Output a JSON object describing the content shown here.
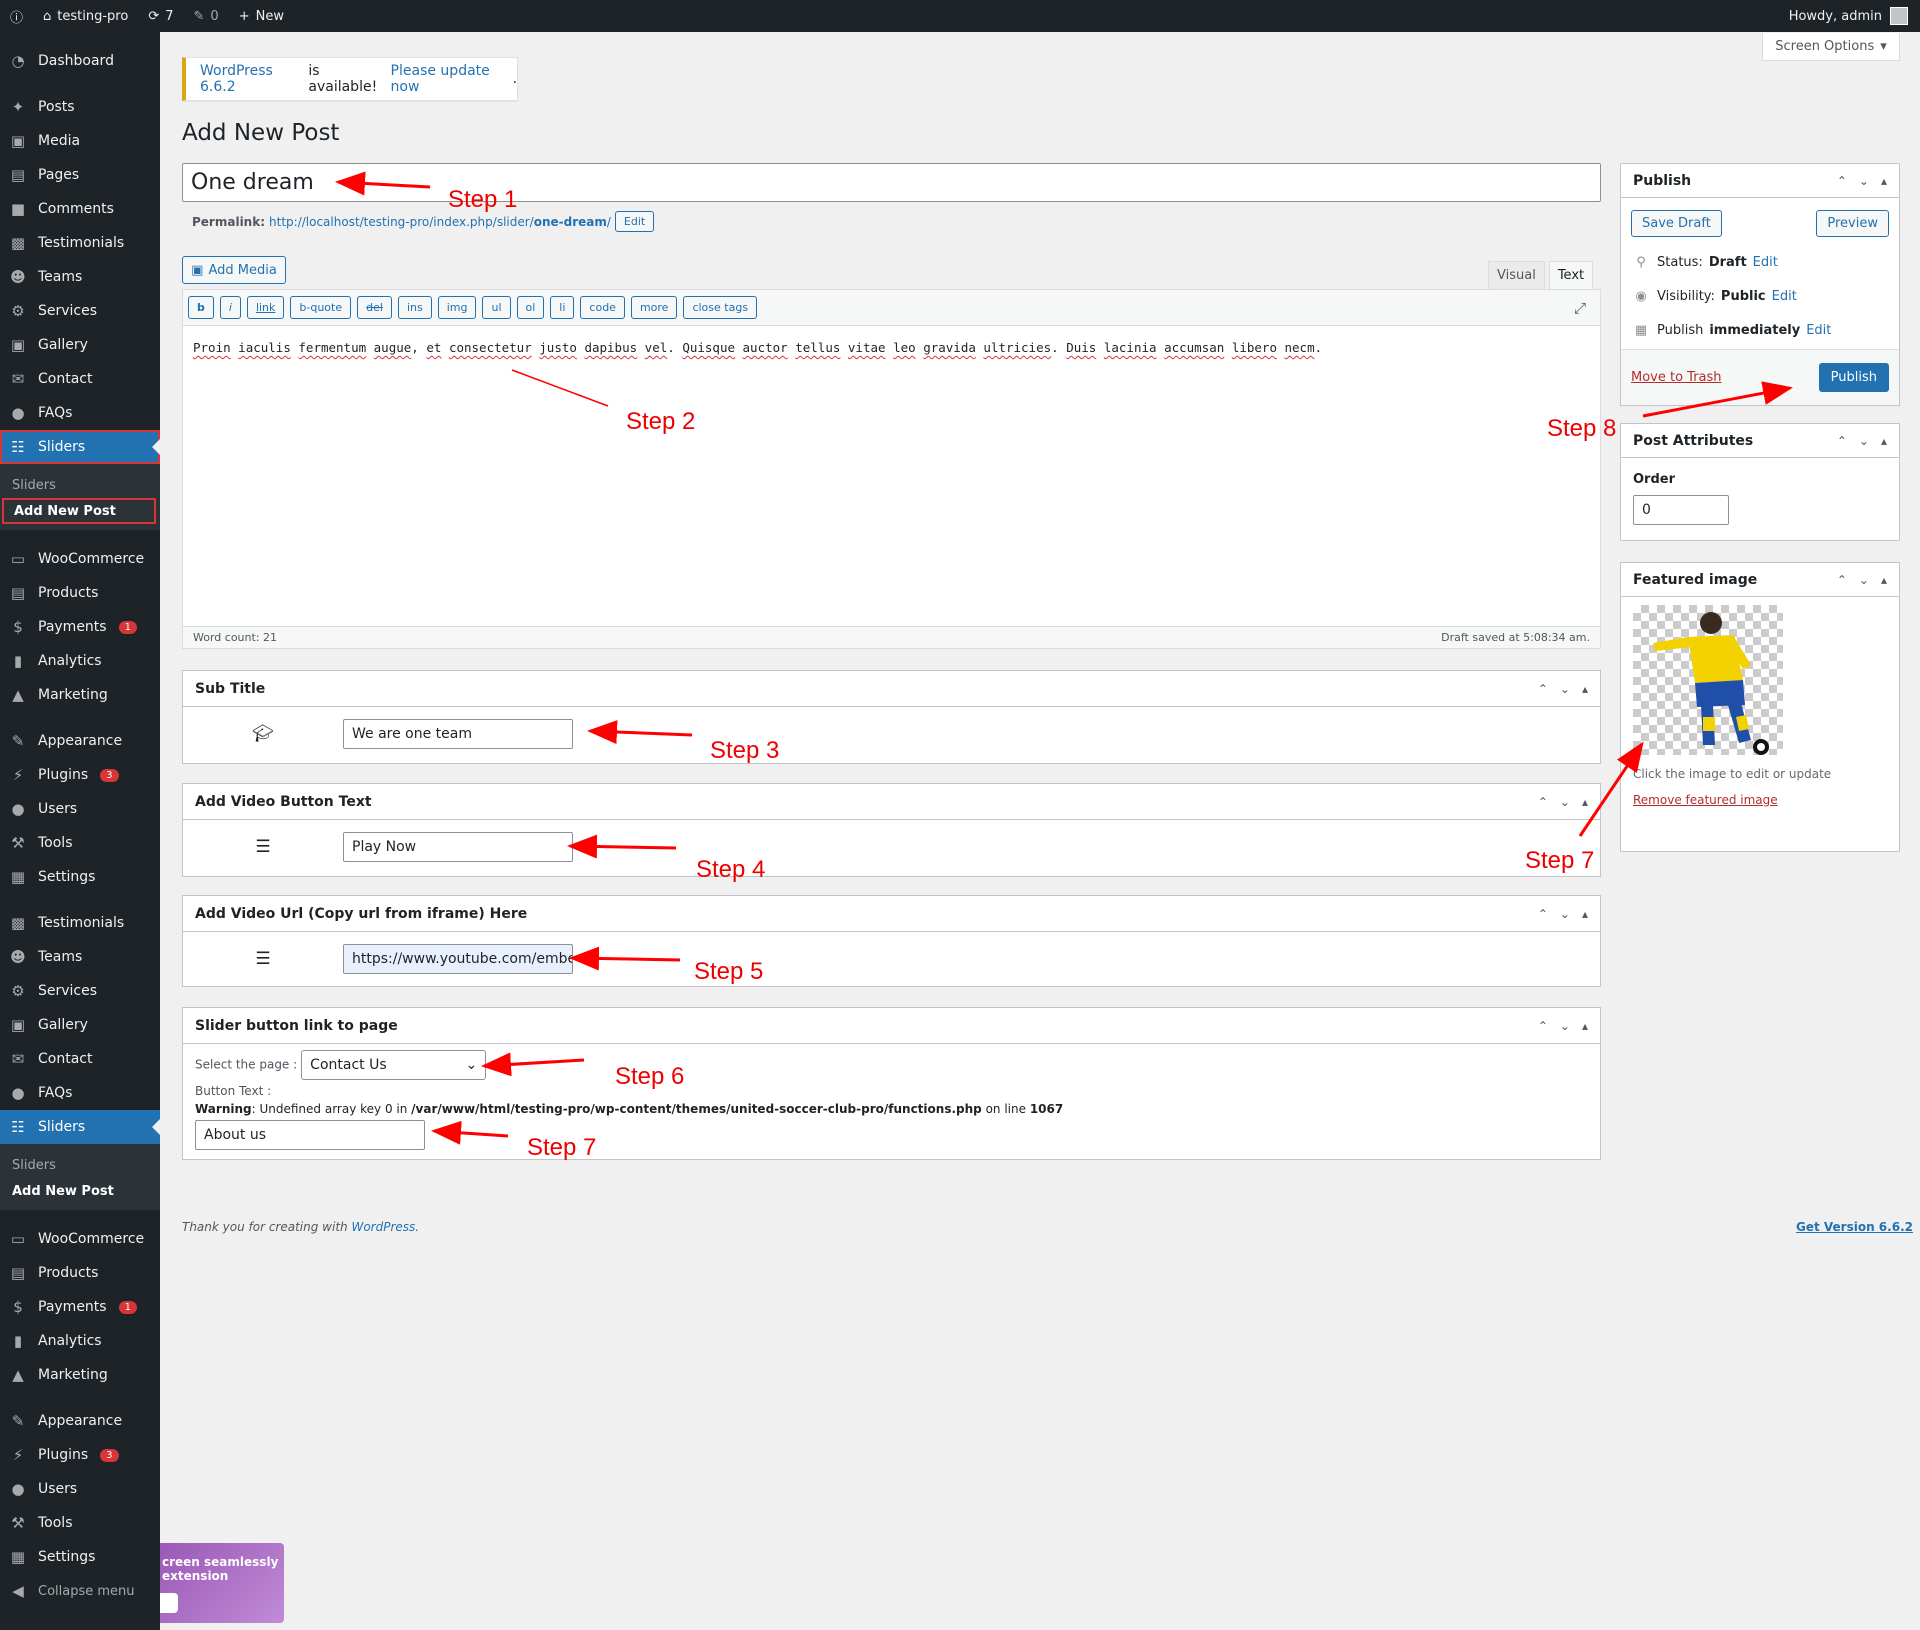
{
  "adminbar": {
    "site_name": "testing-pro",
    "updates_count": "7",
    "comments_count": "0",
    "new_label": "New",
    "howdy": "Howdy, admin"
  },
  "screen_options": "Screen Options",
  "notice": {
    "version_link": "WordPress 6.6.2",
    "text": "is available!",
    "update_link": "Please update now",
    "period": "."
  },
  "page_title": "Add New Post",
  "post": {
    "title": "One dream",
    "permalink_label": "Permalink:",
    "permalink_base": "http://localhost/testing-pro/index.php/slider/",
    "permalink_slug": "one-dream",
    "permalink_trail": "/",
    "edit_label": "Edit"
  },
  "editor": {
    "add_media": "Add Media",
    "tab_visual": "Visual",
    "tab_text": "Text",
    "buttons": [
      "b",
      "i",
      "link",
      "b-quote",
      "del",
      "ins",
      "img",
      "ul",
      "ol",
      "li",
      "code",
      "more",
      "close tags"
    ],
    "content_words": [
      "Proin",
      "iaculis",
      "fermentum",
      "augue,",
      "et",
      "consectetur",
      "justo",
      "dapibus",
      "vel.",
      "Quisque",
      "auctor",
      "tellus",
      "vitae",
      "leo",
      "gravida",
      "ultricies.",
      "Duis",
      "lacinia",
      "accumsan",
      "libero",
      "necm."
    ],
    "word_count": "Word count: 21",
    "draft_saved": "Draft saved at 5:08:34 am."
  },
  "metaboxes": {
    "subtitle": {
      "title": "Sub Title",
      "value": "We are one team"
    },
    "video_button": {
      "title": "Add Video Button Text",
      "value": "Play Now"
    },
    "video_url": {
      "title": "Add Video Url (Copy url from iframe) Here",
      "value": "https://www.youtube.com/embed"
    },
    "slider_link": {
      "title": "Slider button link to page",
      "select_label": "Select the page :",
      "select_value": "Contact Us",
      "button_text_label": "Button Text :",
      "warning_label": "Warning",
      "warning_text": ": Undefined array key 0 in",
      "warning_path": "/var/www/html/testing-pro/wp-content/themes/united-soccer-club-pro/functions.php",
      "warning_on_line": "on line",
      "warning_line": "1067",
      "button_text_value": "About us"
    }
  },
  "publish": {
    "title": "Publish",
    "save_draft": "Save Draft",
    "preview": "Preview",
    "status_label": "Status:",
    "status_value": "Draft",
    "visibility_label": "Visibility:",
    "visibility_value": "Public",
    "publish_label": "Publish",
    "publish_value": "immediately",
    "edit": "Edit",
    "move_to_trash": "Move to Trash",
    "publish_button": "Publish"
  },
  "post_attributes": {
    "title": "Post Attributes",
    "order_label": "Order",
    "order_value": "0"
  },
  "featured_image": {
    "title": "Featured image",
    "hint": "Click the image to edit or update",
    "remove": "Remove featured image"
  },
  "footer": {
    "thanks": "Thank you for creating with",
    "wp_link": "WordPress",
    "period": ".",
    "version": "Get Version 6.6.2"
  },
  "sidebar": {
    "group1": [
      "Dashboard",
      "Posts",
      "Media",
      "Pages",
      "Comments",
      "Testimonials",
      "Teams",
      "Services",
      "Gallery",
      "Contact",
      "FAQs",
      "Sliders"
    ],
    "sub": [
      "Sliders",
      "Add New Post"
    ],
    "group2": [
      "WooCommerce",
      "Products",
      "Payments",
      "Analytics",
      "Marketing"
    ],
    "group3": [
      "Appearance",
      "Plugins",
      "Users",
      "Tools",
      "Settings"
    ],
    "group4": [
      "Testimonials",
      "Teams",
      "Services",
      "Gallery",
      "Contact",
      "FAQs",
      "Sliders"
    ],
    "payments_badge": "1",
    "plugins_badge": "3",
    "collapse": "Collapse menu"
  },
  "promo": {
    "line1": "creen seamlessly",
    "line2": "extension"
  },
  "steps": [
    "Step 1",
    "Step 2",
    "Step 3",
    "Step 4",
    "Step 5",
    "Step 6",
    "Step 7",
    "Step 7",
    "Step 8"
  ],
  "colors": {
    "sidebar_bg": "#1d2327",
    "accent": "#2271b1",
    "annotation": "#ff0000",
    "warning_border": "#dba617"
  }
}
